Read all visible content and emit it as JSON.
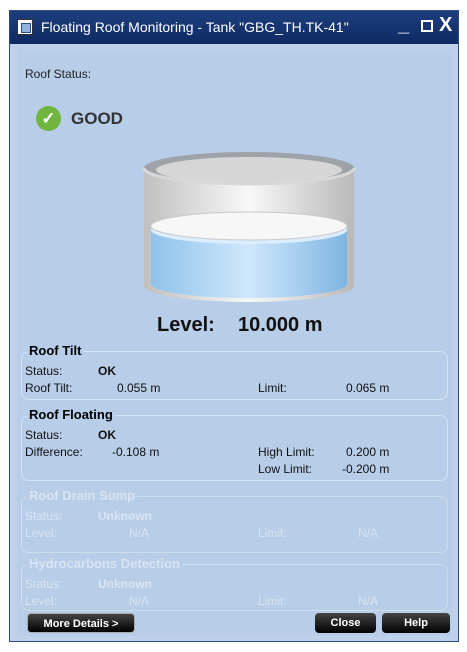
{
  "window": {
    "title": "Floating Roof Monitoring - Tank \"GBG_TH.TK-41\"",
    "minimize_symbol": "_",
    "maximize_symbol": "□",
    "close_symbol": "X"
  },
  "roof_status": {
    "label": "Roof Status:",
    "value": "GOOD",
    "icon": "check-circle-icon"
  },
  "level": {
    "label": "Level:",
    "value": "10.000",
    "unit": "m",
    "display": "10.000   m"
  },
  "groups": {
    "roof_tilt": {
      "title": "Roof Tilt",
      "status_label": "Status:",
      "status_value": "OK",
      "tilt_label": "Roof Tilt:",
      "tilt_value": "0.055 m",
      "limit_label": "Limit:",
      "limit_value": "0.065 m"
    },
    "roof_floating": {
      "title": "Roof Floating",
      "status_label": "Status:",
      "status_value": "OK",
      "difference_label": "Difference:",
      "difference_value": "-0.108 m",
      "high_limit_label": "High Limit:",
      "high_limit_value": "0.200 m",
      "low_limit_label": "Low Limit:",
      "low_limit_value": "-0.200 m"
    },
    "roof_drain_sump": {
      "title": "Roof Drain Sump",
      "status_label": "Status:",
      "status_value": "Unknown",
      "level_label": "Level:",
      "level_value": "N/A",
      "limit_label": "Limit:",
      "limit_value": "N/A"
    },
    "hydrocarbons_detection": {
      "title": "Hydrocarbons Detection",
      "status_label": "Status:",
      "status_value": "Unknown",
      "level_label": "Level:",
      "level_value": "N/A",
      "limit_label": "Limit:",
      "limit_value": "N/A"
    }
  },
  "buttons": {
    "more_details": "More Details >",
    "close": "Close",
    "help": "Help"
  },
  "colors": {
    "accent": "#6fb53e",
    "background": "#b7cde8",
    "titlebar": "#0e2a63"
  }
}
